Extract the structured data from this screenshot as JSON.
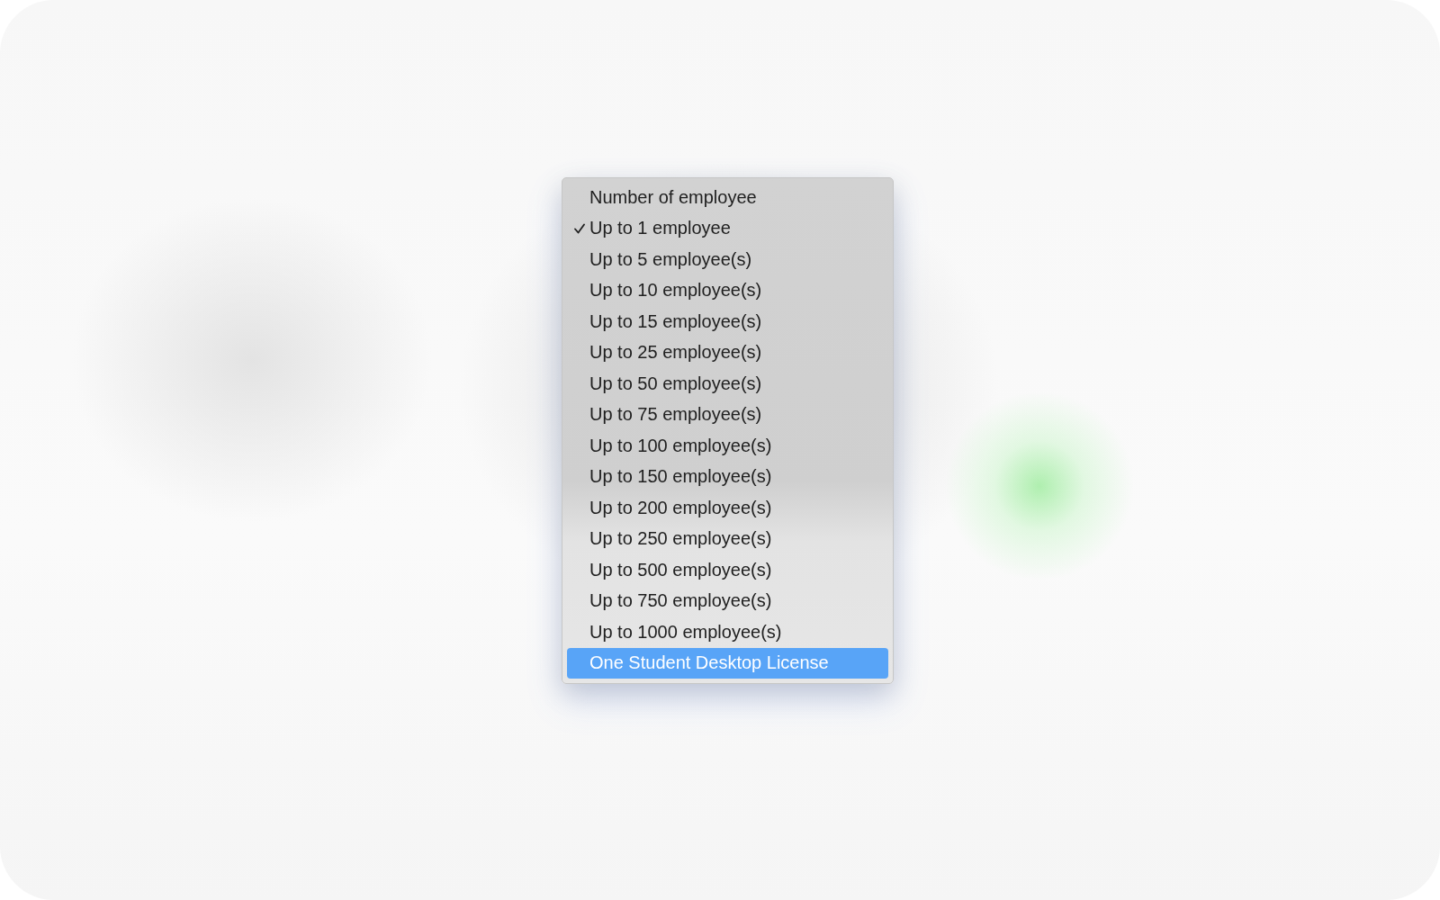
{
  "menu": {
    "items": [
      {
        "label": "Number of employee",
        "checked": false,
        "selected": false
      },
      {
        "label": "Up to 1 employee",
        "checked": true,
        "selected": false
      },
      {
        "label": "Up to 5 employee(s)",
        "checked": false,
        "selected": false
      },
      {
        "label": "Up to 10 employee(s)",
        "checked": false,
        "selected": false
      },
      {
        "label": "Up to 15 employee(s)",
        "checked": false,
        "selected": false
      },
      {
        "label": "Up to 25 employee(s)",
        "checked": false,
        "selected": false
      },
      {
        "label": "Up to 50 employee(s)",
        "checked": false,
        "selected": false
      },
      {
        "label": "Up to 75 employee(s)",
        "checked": false,
        "selected": false
      },
      {
        "label": "Up to 100 employee(s)",
        "checked": false,
        "selected": false
      },
      {
        "label": "Up to 150 employee(s)",
        "checked": false,
        "selected": false
      },
      {
        "label": "Up to 200 employee(s)",
        "checked": false,
        "selected": false
      },
      {
        "label": "Up to 250 employee(s)",
        "checked": false,
        "selected": false
      },
      {
        "label": "Up to 500 employee(s)",
        "checked": false,
        "selected": false
      },
      {
        "label": "Up to 750 employee(s)",
        "checked": false,
        "selected": false
      },
      {
        "label": "Up to 1000 employee(s)",
        "checked": false,
        "selected": false
      },
      {
        "label": "One Student Desktop License",
        "checked": false,
        "selected": true
      }
    ]
  }
}
